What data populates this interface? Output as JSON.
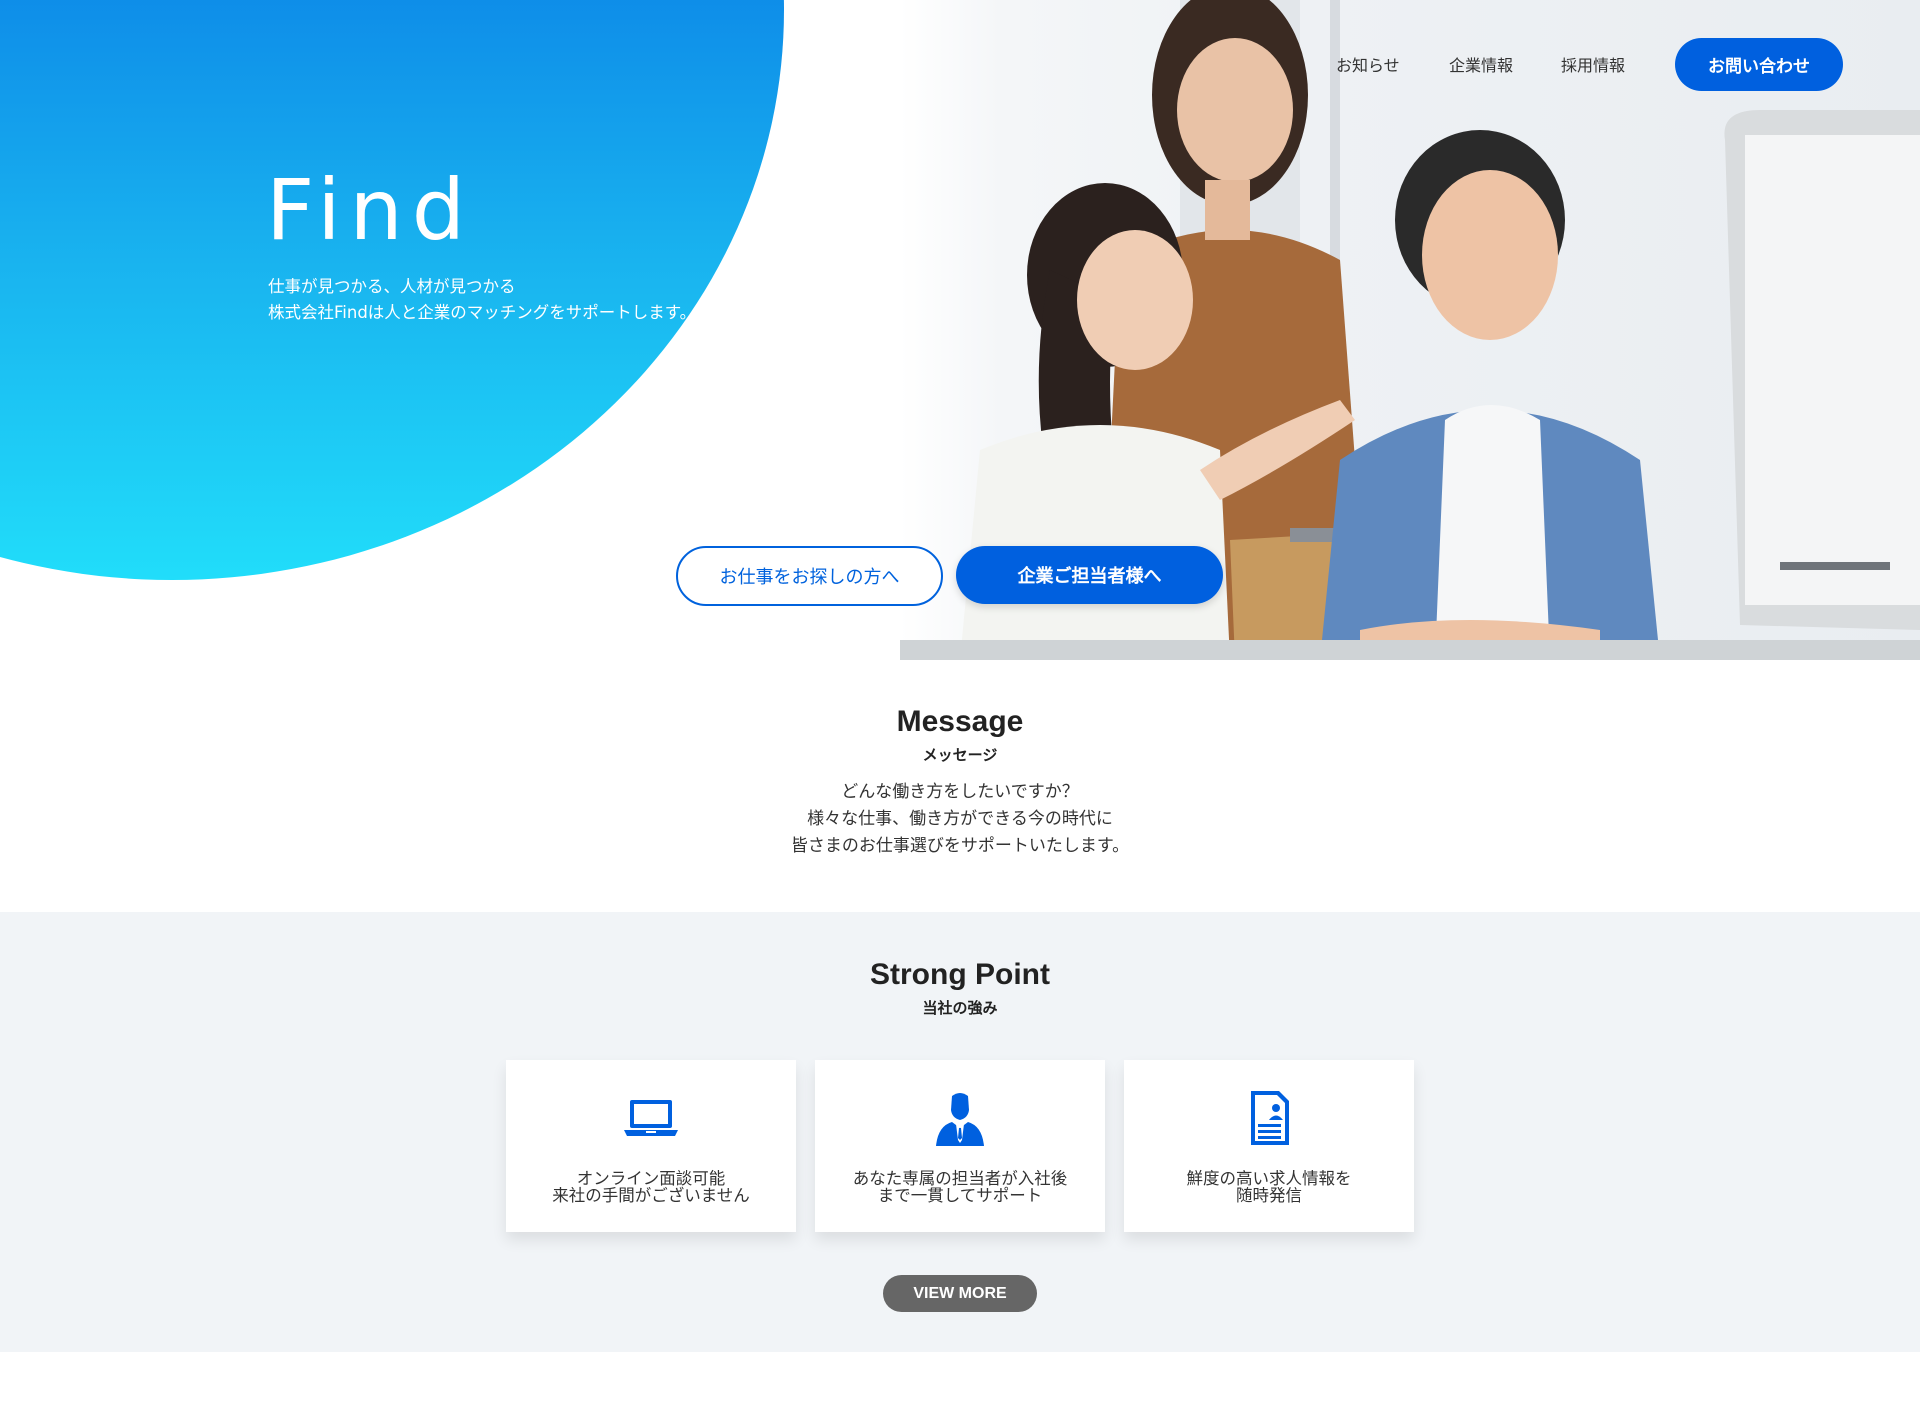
{
  "hero": {
    "title": "Find",
    "subtitle_line1": "仕事が見つかる、人材が見つかる",
    "subtitle_line2": "株式会社Findは人と企業のマッチングをサポートします。",
    "cta_jobseeker": "お仕事をお探しの方へ",
    "cta_company": "企業ご担当者様へ"
  },
  "nav": {
    "items": [
      "お知らせ",
      "企業情報",
      "採用情報"
    ],
    "contact": "お問い合わせ"
  },
  "message": {
    "title": "Message",
    "subtitle": "メッセージ",
    "lines": [
      "どんな働き方をしたいですか？",
      "様々な仕事、働き方ができる今の時代に",
      "皆さまのお仕事選びをサポートいたします。"
    ]
  },
  "strong_point": {
    "title": "Strong Point",
    "subtitle": "当社の強み",
    "cards": [
      {
        "icon": "laptop-icon",
        "line1": "オンライン面談可能",
        "line2": "来社の手間がございません"
      },
      {
        "icon": "businessman-icon",
        "line1": "あなた専属の担当者が入社後",
        "line2": "まで一貫してサポート"
      },
      {
        "icon": "resume-document-icon",
        "line1": "鮮度の高い求人情報を",
        "line2": "随時発信"
      }
    ],
    "view_more": "VIEW MORE"
  },
  "colors": {
    "brand_blue": "#0060df",
    "gradient_top": "#0060e0",
    "gradient_bottom": "#21ddfa",
    "section_bg": "#f1f4f7",
    "view_more_bg": "#666666"
  }
}
